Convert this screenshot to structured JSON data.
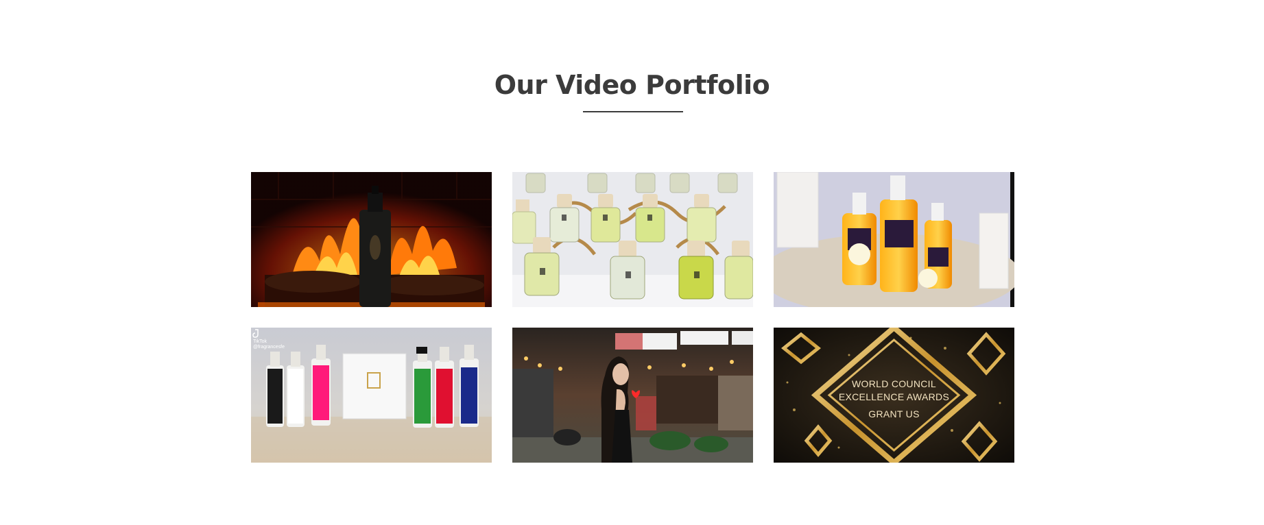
{
  "section": {
    "title": "Our Video Portfolio"
  },
  "videos": [
    {
      "subject": "fireplace-bottle"
    },
    {
      "subject": "car-diffuser-bottles"
    },
    {
      "subject": "victorias-secret-mists"
    },
    {
      "subject": "color-bottles-tiktok",
      "overlay": {
        "brand": "TikTok",
        "handle": "@fragrancesfe"
      }
    },
    {
      "subject": "night-street-model"
    },
    {
      "subject": "awards-title",
      "overlay": {
        "line1": "WORLD COUNCIL",
        "line2": "EXCELLENCE AWARDS",
        "line3": "GRANT US"
      }
    }
  ]
}
